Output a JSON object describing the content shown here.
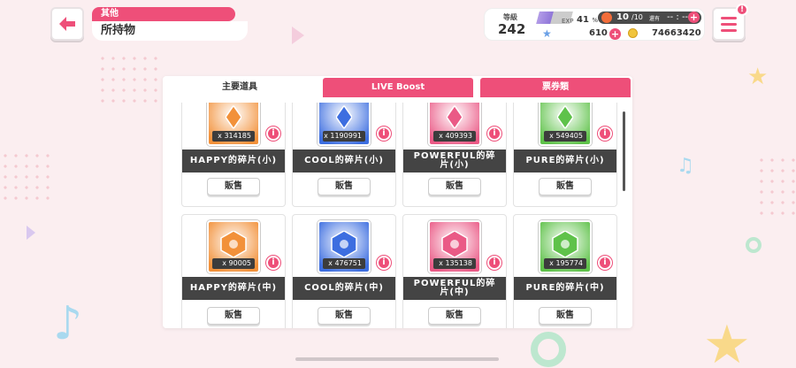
{
  "header": {
    "category": "其他",
    "title": "所持物"
  },
  "status": {
    "rank_label": "等級",
    "rank": "242",
    "exp_label": "EXP",
    "exp_pct": "41",
    "exp_pct_unit": "%",
    "exp_fraction": 0.41,
    "lp_current": "10",
    "lp_max": "/10",
    "lp_recover_label": "還有",
    "lp_timer": "-- : --",
    "star_gems": "610",
    "coins": "74663420"
  },
  "tabs": [
    {
      "label": "主要道具"
    },
    {
      "label": "LIVE Boost"
    },
    {
      "label": "票券類"
    }
  ],
  "items": [
    {
      "name": "HAPPY的碎片(小)",
      "qty": "x 314185",
      "color": "#f2913a",
      "sell": "販售"
    },
    {
      "name": "COOL的碎片(小)",
      "qty": "x 1190991",
      "color": "#3d6ee0",
      "sell": "販售"
    },
    {
      "name": "POWERFUL的碎片(小)",
      "qty": "x 409393",
      "color": "#ea5a86",
      "sell": "販售"
    },
    {
      "name": "PURE的碎片(小)",
      "qty": "x 549405",
      "color": "#5fc24a",
      "sell": "販售"
    },
    {
      "name": "HAPPY的碎片(中)",
      "qty": "x 90005",
      "color": "#f2913a",
      "sell": "販售"
    },
    {
      "name": "COOL的碎片(中)",
      "qty": "x 476751",
      "color": "#3d6ee0",
      "sell": "販售"
    },
    {
      "name": "POWERFUL的碎片(中)",
      "qty": "x 135138",
      "color": "#ea5a86",
      "sell": "販售"
    },
    {
      "name": "PURE的碎片(中)",
      "qty": "x 195774",
      "color": "#5fc24a",
      "sell": "販售"
    }
  ],
  "colors": {
    "accent": "#ee4f79",
    "dark_bar": "#444444",
    "background": "#fbeef0"
  }
}
